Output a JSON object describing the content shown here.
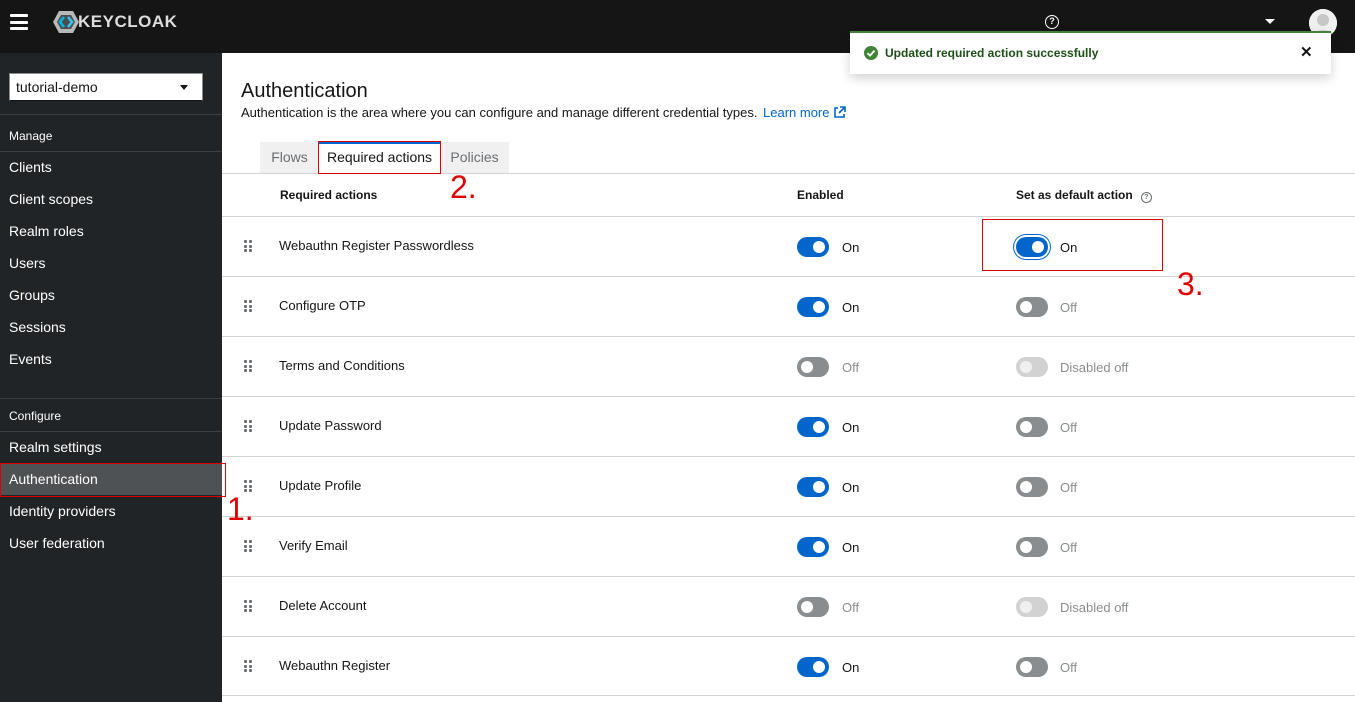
{
  "header": {
    "logo_text": "KEYCLOAK",
    "help_symbol": "?",
    "user_menu_icon": "chevron-down-icon",
    "avatar_icon": "user-avatar-icon"
  },
  "sidebar": {
    "realm": "tutorial-demo",
    "manage_title": "Manage",
    "manage_items": [
      {
        "label": "Clients"
      },
      {
        "label": "Client scopes"
      },
      {
        "label": "Realm roles"
      },
      {
        "label": "Users"
      },
      {
        "label": "Groups"
      },
      {
        "label": "Sessions"
      },
      {
        "label": "Events"
      }
    ],
    "configure_title": "Configure",
    "configure_items": [
      {
        "label": "Realm settings"
      },
      {
        "label": "Authentication"
      },
      {
        "label": "Identity providers"
      },
      {
        "label": "User federation"
      }
    ],
    "active_item": "Authentication"
  },
  "page": {
    "title": "Authentication",
    "description": "Authentication is the area where you can configure and manage different credential types.",
    "learn_more": "Learn more"
  },
  "tabs": [
    {
      "label": "Flows"
    },
    {
      "label": "Required actions"
    },
    {
      "label": "Policies"
    }
  ],
  "active_tab": "Required actions",
  "table": {
    "headers": {
      "name": "Required actions",
      "enabled": "Enabled",
      "default": "Set as default action",
      "default_help": "?"
    },
    "rows": [
      {
        "name": "Webauthn Register Passwordless",
        "enabled": "On",
        "default": "On"
      },
      {
        "name": "Configure OTP",
        "enabled": "On",
        "default": "Off"
      },
      {
        "name": "Terms and Conditions",
        "enabled": "Off",
        "default": "Disabled off"
      },
      {
        "name": "Update Password",
        "enabled": "On",
        "default": "Off"
      },
      {
        "name": "Update Profile",
        "enabled": "On",
        "default": "Off"
      },
      {
        "name": "Verify Email",
        "enabled": "On",
        "default": "Off"
      },
      {
        "name": "Delete Account",
        "enabled": "Off",
        "default": "Disabled off"
      },
      {
        "name": "Webauthn Register",
        "enabled": "On",
        "default": "Off"
      }
    ]
  },
  "toast": {
    "message": "Updated required action successfully",
    "close_symbol": "✕",
    "status_color": "#3e8635"
  },
  "annotations": [
    "1.",
    "2.",
    "3."
  ],
  "colors": {
    "accent": "#0066cc",
    "header_bg": "#151515",
    "sidebar_bg": "#212427",
    "annotation_red": "#e00000"
  }
}
